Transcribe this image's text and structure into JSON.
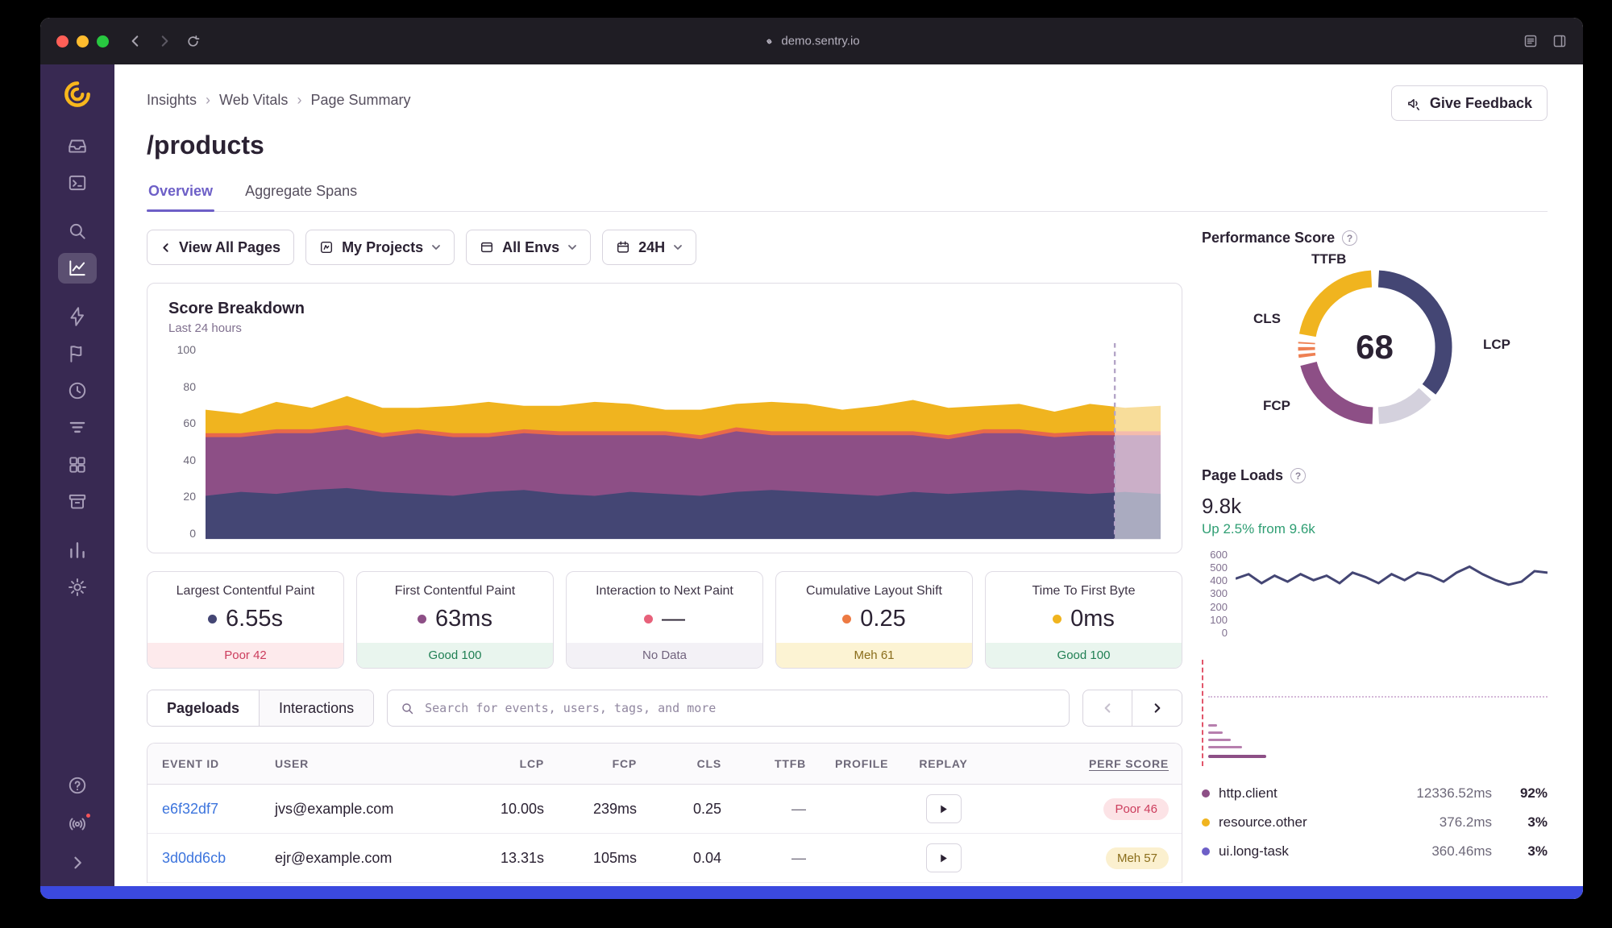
{
  "browser": {
    "url": "demo.sentry.io"
  },
  "header": {
    "breadcrumb": [
      "Insights",
      "Web Vitals",
      "Page Summary"
    ],
    "feedback_label": "Give Feedback",
    "title": "/products"
  },
  "tabs": {
    "overview": "Overview",
    "aggregate_spans": "Aggregate Spans"
  },
  "filters": {
    "view_all_label": "View All Pages",
    "projects_label": "My Projects",
    "envs_label": "All Envs",
    "date_label": "24H"
  },
  "score_breakdown": {
    "title": "Score Breakdown",
    "subtitle": "Last 24 hours",
    "y_ticks": [
      "100",
      "80",
      "60",
      "40",
      "20",
      "0"
    ],
    "y_max": 100,
    "series": [
      {
        "name": "lcp",
        "color": "#444674",
        "values": [
          22,
          24,
          23,
          25,
          26,
          24,
          23,
          22,
          24,
          25,
          23,
          22,
          24,
          23,
          22,
          24,
          25,
          24,
          23,
          22,
          24,
          23,
          24,
          25,
          24,
          23,
          24,
          23
        ]
      },
      {
        "name": "fcp",
        "color": "#8d4f86",
        "values": [
          30,
          28,
          31,
          29,
          30,
          28,
          31,
          30,
          28,
          29,
          30,
          31,
          29,
          30,
          29,
          31,
          28,
          29,
          30,
          31,
          29,
          28,
          30,
          29,
          28,
          30,
          29,
          30
        ]
      },
      {
        "name": "cls",
        "color": "#e8684a",
        "values": [
          2,
          2,
          2,
          2,
          2,
          2,
          2,
          2,
          2,
          2,
          2,
          2,
          2,
          2,
          2,
          2,
          2,
          2,
          2,
          2,
          2,
          2,
          2,
          2,
          2,
          2,
          2,
          2
        ]
      },
      {
        "name": "ttfb",
        "color": "#f0b41f",
        "values": [
          12,
          10,
          14,
          11,
          15,
          13,
          11,
          14,
          16,
          12,
          13,
          15,
          14,
          11,
          13,
          12,
          15,
          14,
          11,
          13,
          16,
          14,
          12,
          13,
          11,
          14,
          12,
          13
        ]
      }
    ]
  },
  "vitals_cards": [
    {
      "title": "Largest Contentful Paint",
      "value": "6.55s",
      "dot_color": "#444674",
      "status": "Poor 42"
    },
    {
      "title": "First Contentful Paint",
      "value": "63ms",
      "dot_color": "#8d4f86",
      "status": "Good 100"
    },
    {
      "title": "Interaction to Next Paint",
      "value": "—",
      "dot_color": "#e7617a",
      "status": "No Data"
    },
    {
      "title": "Cumulative Layout Shift",
      "value": "0.25",
      "dot_color": "#ed7a43",
      "status": "Meh 61"
    },
    {
      "title": "Time To First Byte",
      "value": "0ms",
      "dot_color": "#f0b41f",
      "status": "Good 100"
    }
  ],
  "list_controls": {
    "pageloads_label": "Pageloads",
    "interactions_label": "Interactions",
    "search_placeholder": "Search for events, users, tags, and more"
  },
  "samples_table": {
    "columns": [
      "EVENT ID",
      "USER",
      "LCP",
      "FCP",
      "CLS",
      "TTFB",
      "PROFILE",
      "REPLAY",
      "PERF SCORE"
    ],
    "rows": [
      {
        "event_id": "e6f32df7",
        "user": "jvs@example.com",
        "lcp": "10.00s",
        "fcp": "239ms",
        "cls": "0.25",
        "ttfb": "—",
        "profile": "",
        "score": "Poor 46"
      },
      {
        "event_id": "3d0dd6cb",
        "user": "ejr@example.com",
        "lcp": "13.31s",
        "fcp": "105ms",
        "cls": "0.04",
        "ttfb": "—",
        "profile": "",
        "score": "Meh 57"
      }
    ]
  },
  "performance_score": {
    "title": "Performance Score",
    "value": "68",
    "labels": {
      "ttfb": "TTFB",
      "cls": "CLS",
      "fcp": "FCP",
      "lcp": "LCP"
    },
    "segments": [
      {
        "name": "lcp",
        "color": "#444674",
        "start": 3,
        "end": 128
      },
      {
        "name": "remainder",
        "color": "#d4d1dd",
        "start": 133,
        "end": 177
      },
      {
        "name": "fcp",
        "color": "#8d4f86",
        "start": 182,
        "end": 256
      },
      {
        "name": "cls",
        "color": "#ee8053",
        "start": 262,
        "end": 274,
        "dashed": true
      },
      {
        "name": "ttfb",
        "color": "#f0b41f",
        "start": 280,
        "end": 357
      }
    ]
  },
  "page_loads": {
    "title": "Page Loads",
    "value": "9.8k",
    "delta": "Up 2.5% from 9.6k",
    "y_ticks": [
      "600",
      "500",
      "400",
      "300",
      "200",
      "100",
      "0"
    ],
    "y_max": 600,
    "values": [
      400,
      430,
      370,
      420,
      380,
      430,
      390,
      420,
      370,
      440,
      410,
      370,
      430,
      390,
      440,
      420,
      380,
      440,
      480,
      430,
      390,
      360,
      380,
      450,
      440
    ]
  },
  "span_list": [
    {
      "name": "http.client",
      "duration": "12336.52ms",
      "percent": "92%",
      "dot_color": "#8d4f86"
    },
    {
      "name": "resource.other",
      "duration": "376.2ms",
      "percent": "3%",
      "dot_color": "#f0b41f"
    },
    {
      "name": "ui.long-task",
      "duration": "360.46ms",
      "percent": "3%",
      "dot_color": "#6d5fc7"
    }
  ],
  "colors": {
    "accent": "#6d5fc7",
    "link": "#3c74dd",
    "good": "#1f7f53",
    "meh": "#8a6d1b",
    "poor": "#cc3d5d",
    "banner_blue": "#3b49df",
    "sidebar": "#382952"
  }
}
